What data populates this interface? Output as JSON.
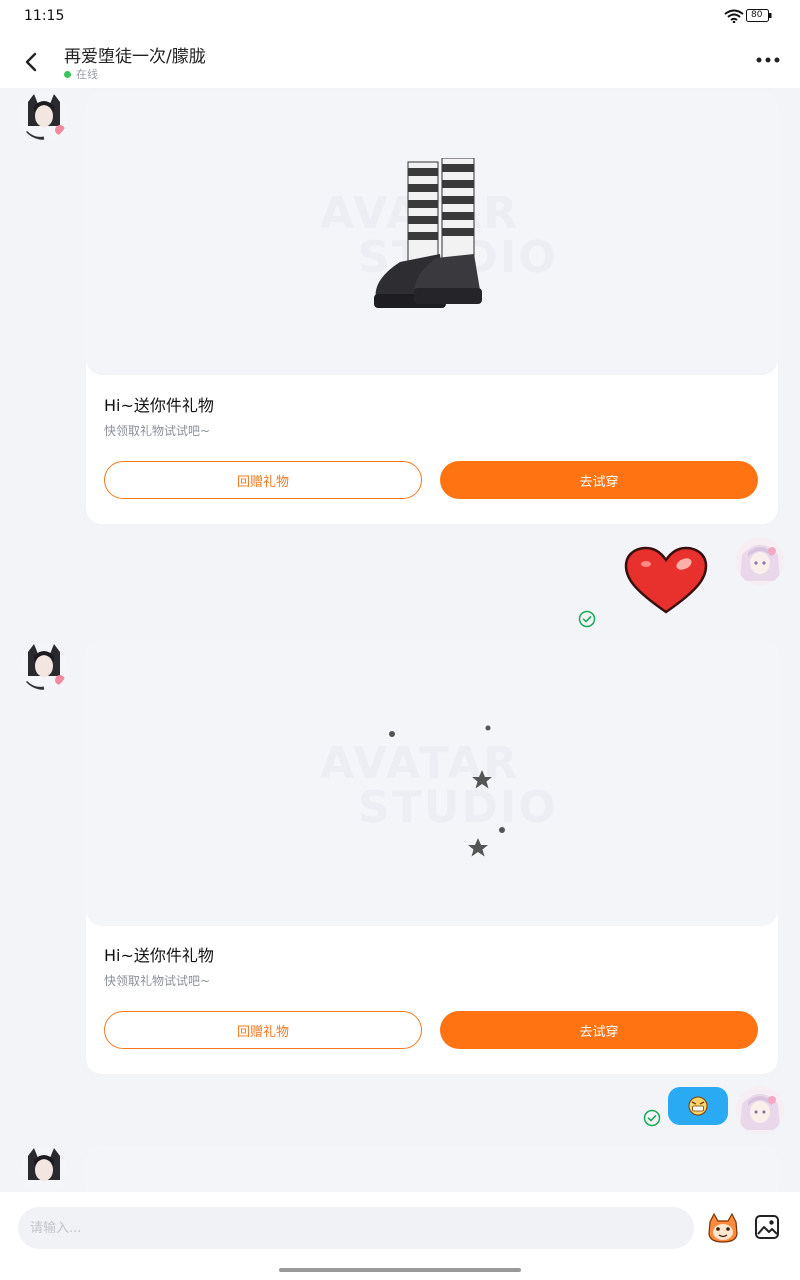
{
  "status_bar": {
    "time": "11:15",
    "battery": "80"
  },
  "header": {
    "title": "再爱堕徒一次/朦胧",
    "status": "在线"
  },
  "gift_cards": [
    {
      "title": "Hi~送你件礼物",
      "subtitle": "快领取礼物试试吧~",
      "return_gift_label": "回赠礼物",
      "try_on_label": "去试穿",
      "watermark_line1": "AVATAR",
      "watermark_line2": "STUDIO"
    },
    {
      "title": "Hi~送你件礼物",
      "subtitle": "快领取礼物试试吧~",
      "return_gift_label": "回赠礼物",
      "try_on_label": "去试穿",
      "watermark_line1": "AVATAR",
      "watermark_line2": "STUDIO"
    }
  ],
  "input": {
    "placeholder": "请输入..."
  },
  "colors": {
    "accent": "#ff7313",
    "online": "#3cc35c",
    "bubble": "#29aaf2",
    "sent_check": "#1aaa55"
  },
  "icons": [
    "back-icon",
    "more-icon",
    "heart-sticker",
    "sent-check-icon",
    "emoji-icon",
    "image-icon"
  ]
}
